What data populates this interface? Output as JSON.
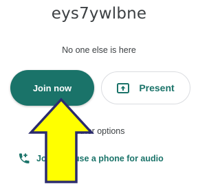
{
  "meeting": {
    "title": "eys7ywlbne",
    "status": "No one else is here"
  },
  "actions": {
    "join_label": "Join now",
    "present_label": "Present",
    "other_options_label": "Other options",
    "phone_label": "Join and use a phone for audio"
  },
  "icons": {
    "present": "present-screen-icon",
    "phone": "phone-add-icon",
    "annotation": "yellow-arrow-pointer"
  },
  "colors": {
    "accent": "#1a7369",
    "text": "#3c4043",
    "arrow_fill": "#ffff00",
    "arrow_stroke": "#2b2b6e"
  }
}
